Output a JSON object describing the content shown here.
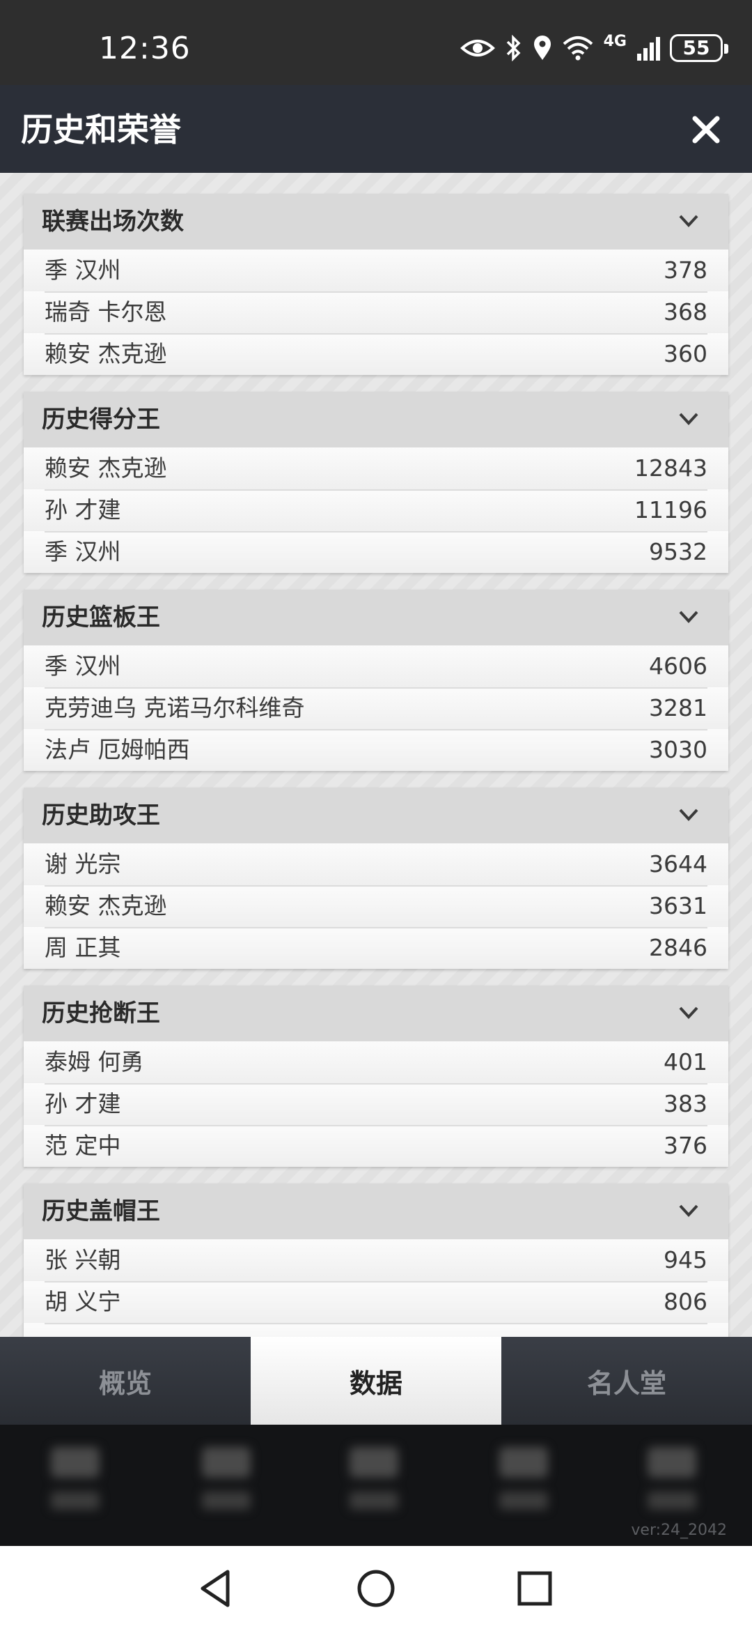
{
  "status_bar": {
    "time": "12:36",
    "network": "4G",
    "battery": "55"
  },
  "header": {
    "title": "历史和荣誉"
  },
  "cards": [
    {
      "title": "联赛出场次数",
      "rows": [
        {
          "name": "季 汉州",
          "value": "378"
        },
        {
          "name": "瑞奇 卡尔恩",
          "value": "368"
        },
        {
          "name": "赖安 杰克逊",
          "value": "360"
        }
      ]
    },
    {
      "title": "历史得分王",
      "rows": [
        {
          "name": "赖安 杰克逊",
          "value": "12843"
        },
        {
          "name": "孙 才建",
          "value": "11196"
        },
        {
          "name": "季 汉州",
          "value": "9532"
        }
      ]
    },
    {
      "title": "历史篮板王",
      "rows": [
        {
          "name": "季 汉州",
          "value": "4606"
        },
        {
          "name": "克劳迪乌 克诺马尔科维奇",
          "value": "3281"
        },
        {
          "name": "法卢 厄姆帕西",
          "value": "3030"
        }
      ]
    },
    {
      "title": "历史助攻王",
      "rows": [
        {
          "name": "谢 光宗",
          "value": "3644"
        },
        {
          "name": "赖安 杰克逊",
          "value": "3631"
        },
        {
          "name": "周 正其",
          "value": "2846"
        }
      ]
    },
    {
      "title": "历史抢断王",
      "rows": [
        {
          "name": "泰姆 何勇",
          "value": "401"
        },
        {
          "name": "孙 才建",
          "value": "383"
        },
        {
          "name": "范 定中",
          "value": "376"
        }
      ]
    },
    {
      "title": "历史盖帽王",
      "rows": [
        {
          "name": "张 兴朝",
          "value": "945"
        },
        {
          "name": "胡 义宁",
          "value": "806"
        },
        {
          "name": "",
          "value": ""
        }
      ]
    }
  ],
  "tabs": [
    {
      "label": "概览",
      "active": false
    },
    {
      "label": "数据",
      "active": true
    },
    {
      "label": "名人堂",
      "active": false
    }
  ],
  "footer": {
    "version": "ver:24_2042"
  },
  "colors": {
    "header_bg": "#2b2f38",
    "card_header_bg": "#d9d9d9",
    "active_tab_bg": "#ffffff"
  }
}
